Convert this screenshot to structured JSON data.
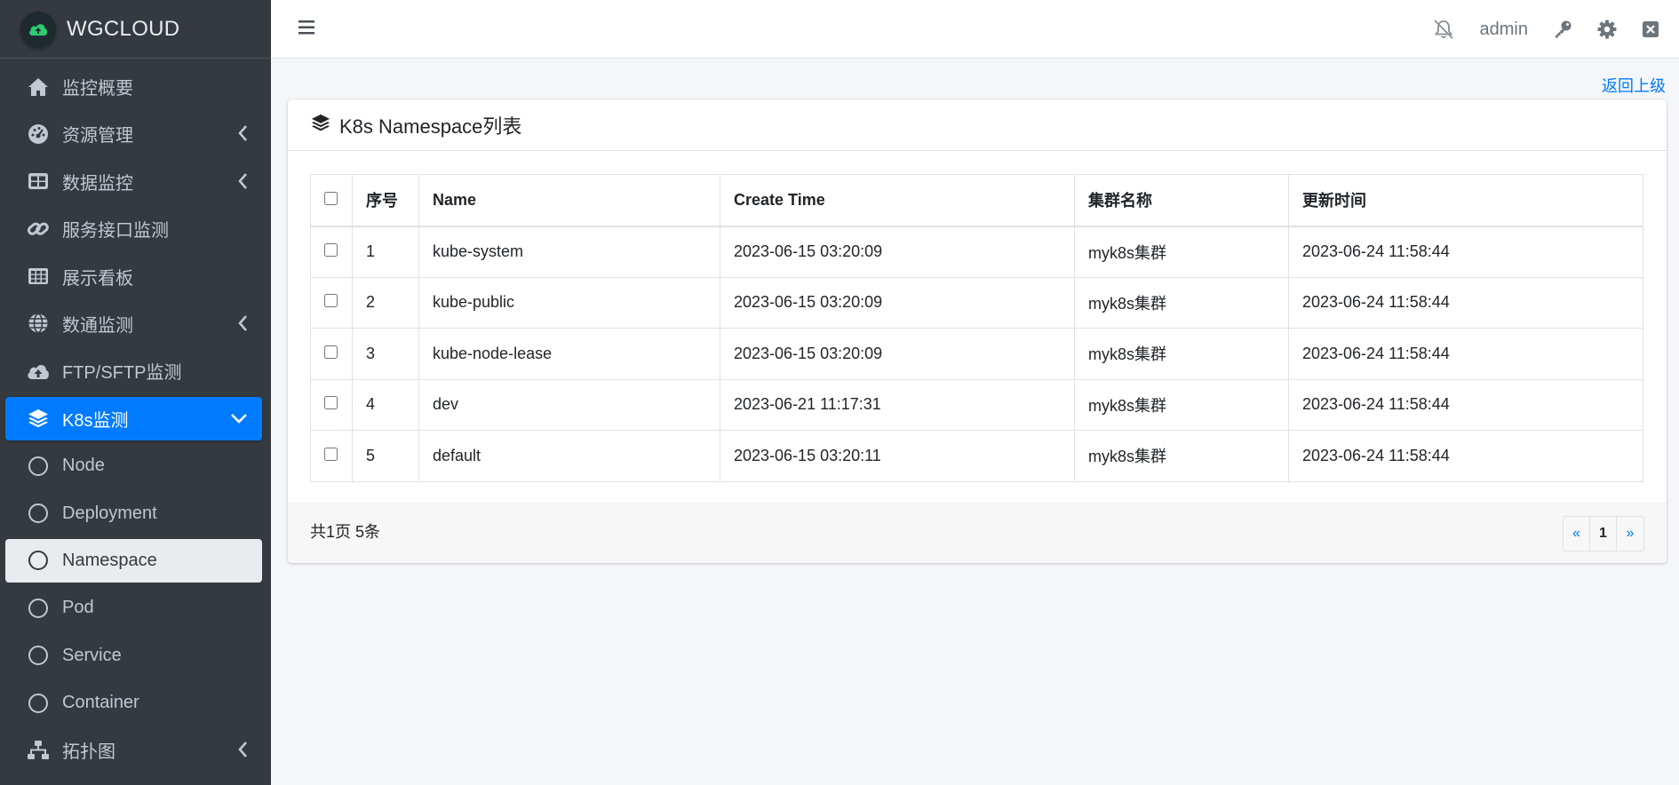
{
  "brand": {
    "name": "WGCLOUD"
  },
  "sidebar": {
    "items": [
      {
        "label": "监控概要",
        "icon": "home-icon"
      },
      {
        "label": "资源管理",
        "icon": "dashboard-icon"
      },
      {
        "label": "数据监控",
        "icon": "table-icon"
      },
      {
        "label": "服务接口监测",
        "icon": "link-icon"
      },
      {
        "label": "展示看板",
        "icon": "grid-icon"
      },
      {
        "label": "数通监测",
        "icon": "globe-icon"
      },
      {
        "label": "FTP/SFTP监测",
        "icon": "cloud-upload-icon"
      },
      {
        "label": "K8s监测",
        "icon": "layers-icon"
      },
      {
        "label": "Node",
        "icon": "circle-icon"
      },
      {
        "label": "Deployment",
        "icon": "circle-icon"
      },
      {
        "label": "Namespace",
        "icon": "circle-icon"
      },
      {
        "label": "Pod",
        "icon": "circle-icon"
      },
      {
        "label": "Service",
        "icon": "circle-icon"
      },
      {
        "label": "Container",
        "icon": "circle-icon"
      },
      {
        "label": "拓扑图",
        "icon": "sitemap-icon"
      }
    ]
  },
  "topbar": {
    "user": "admin"
  },
  "content": {
    "back_label": "返回上级",
    "card_title": "K8s Namespace列表",
    "table": {
      "headers": [
        "序号",
        "Name",
        "Create Time",
        "集群名称",
        "更新时间"
      ],
      "rows": [
        [
          "1",
          "kube-system",
          "2023-06-15 03:20:09",
          "myk8s集群",
          "2023-06-24 11:58:44"
        ],
        [
          "2",
          "kube-public",
          "2023-06-15 03:20:09",
          "myk8s集群",
          "2023-06-24 11:58:44"
        ],
        [
          "3",
          "kube-node-lease",
          "2023-06-15 03:20:09",
          "myk8s集群",
          "2023-06-24 11:58:44"
        ],
        [
          "4",
          "dev",
          "2023-06-21 11:17:31",
          "myk8s集群",
          "2023-06-24 11:58:44"
        ],
        [
          "5",
          "default",
          "2023-06-15 03:20:11",
          "myk8s集群",
          "2023-06-24 11:58:44"
        ]
      ]
    },
    "footer_summary": "共1页 5条",
    "pagination": {
      "prev": "«",
      "current": "1",
      "next": "»"
    }
  },
  "colors": {
    "sidebar_bg": "#343a40",
    "active": "#007bff",
    "link": "#007bff"
  }
}
